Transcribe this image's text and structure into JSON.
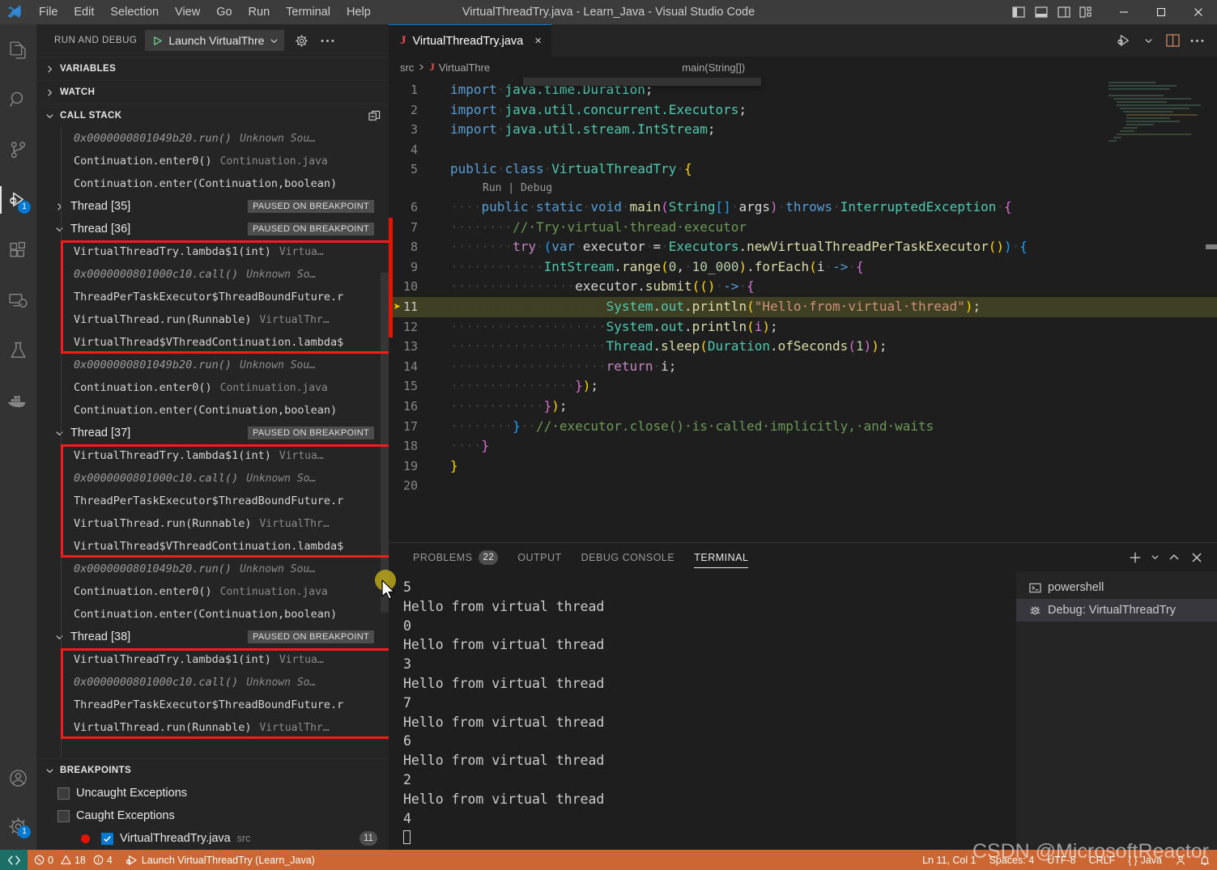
{
  "titlebar": {
    "menus": [
      "File",
      "Edit",
      "Selection",
      "View",
      "Go",
      "Run",
      "Terminal",
      "Help"
    ],
    "window_title": "VirtualThreadTry.java - Learn_Java - Visual Studio Code",
    "layout_icons": [
      "toggle-primary-sidebar-icon",
      "toggle-panel-icon",
      "toggle-secondary-sidebar-icon",
      "customize-layout-icon"
    ],
    "window_controls": [
      "minimize",
      "maximize",
      "close"
    ]
  },
  "activitybar": {
    "items": [
      {
        "name": "explorer-icon",
        "badge": ""
      },
      {
        "name": "search-icon",
        "badge": ""
      },
      {
        "name": "source-control-icon",
        "badge": ""
      },
      {
        "name": "run-and-debug-icon",
        "badge": "1"
      },
      {
        "name": "extensions-icon",
        "badge": ""
      },
      {
        "name": "remote-explorer-icon",
        "badge": ""
      },
      {
        "name": "testing-icon",
        "badge": ""
      },
      {
        "name": "docker-icon",
        "badge": ""
      }
    ],
    "bottom": [
      {
        "name": "accounts-icon",
        "badge": ""
      },
      {
        "name": "settings-gear-icon",
        "badge": "1"
      }
    ]
  },
  "sidebar": {
    "title": "RUN AND DEBUG",
    "launch_config": "Launch VirtualThre",
    "sections": {
      "variables": "VARIABLES",
      "watch": "WATCH",
      "callstack": "CALL STACK",
      "breakpoints": "BREAKPOINTS"
    },
    "paused_badge": "PAUSED ON BREAKPOINT",
    "callstack": [
      {
        "type": "frame",
        "text": "0x0000000801049b20.run()",
        "src": "Unknown Sou…",
        "dim": true
      },
      {
        "type": "frame",
        "text": "Continuation.enter0()",
        "src": "Continuation.java",
        "dim": false
      },
      {
        "type": "frame",
        "text": "Continuation.enter(Continuation,boolean)",
        "src": "",
        "dim": false
      },
      {
        "type": "thread",
        "text": "Thread [35]",
        "expanded": false
      },
      {
        "type": "thread",
        "text": "Thread [36]",
        "expanded": true
      },
      {
        "type": "frame",
        "text": "VirtualThreadTry.lambda$1(int)",
        "src": "Virtua…",
        "dim": false,
        "boxed": true
      },
      {
        "type": "frame",
        "text": "0x0000000801000c10.call()",
        "src": "Unknown So…",
        "dim": true,
        "boxed": true
      },
      {
        "type": "frame",
        "text": "ThreadPerTaskExecutor$ThreadBoundFuture.r",
        "src": "",
        "dim": false,
        "boxed": true
      },
      {
        "type": "frame",
        "text": "VirtualThread.run(Runnable)",
        "src": "VirtualThr…",
        "dim": false,
        "boxed": true
      },
      {
        "type": "frame",
        "text": "VirtualThread$VThreadContinuation.lambda$",
        "src": "",
        "dim": false,
        "boxed": true
      },
      {
        "type": "frame",
        "text": "0x0000000801049b20.run()",
        "src": "Unknown Sou…",
        "dim": true
      },
      {
        "type": "frame",
        "text": "Continuation.enter0()",
        "src": "Continuation.java",
        "dim": false
      },
      {
        "type": "frame",
        "text": "Continuation.enter(Continuation,boolean)",
        "src": "",
        "dim": false
      },
      {
        "type": "thread",
        "text": "Thread [37]",
        "expanded": true
      },
      {
        "type": "frame",
        "text": "VirtualThreadTry.lambda$1(int)",
        "src": "Virtua…",
        "dim": false,
        "boxed": true
      },
      {
        "type": "frame",
        "text": "0x0000000801000c10.call()",
        "src": "Unknown So…",
        "dim": true,
        "boxed": true
      },
      {
        "type": "frame",
        "text": "ThreadPerTaskExecutor$ThreadBoundFuture.r",
        "src": "",
        "dim": false,
        "boxed": true
      },
      {
        "type": "frame",
        "text": "VirtualThread.run(Runnable)",
        "src": "VirtualThr…",
        "dim": false,
        "boxed": true
      },
      {
        "type": "frame",
        "text": "VirtualThread$VThreadContinuation.lambda$",
        "src": "",
        "dim": false,
        "boxed": true
      },
      {
        "type": "frame",
        "text": "0x0000000801049b20.run()",
        "src": "Unknown Sou…",
        "dim": true
      },
      {
        "type": "frame",
        "text": "Continuation.enter0()",
        "src": "Continuation.java",
        "dim": false
      },
      {
        "type": "frame",
        "text": "Continuation.enter(Continuation,boolean)",
        "src": "",
        "dim": false
      },
      {
        "type": "thread",
        "text": "Thread [38]",
        "expanded": true
      },
      {
        "type": "frame",
        "text": "VirtualThreadTry.lambda$1(int)",
        "src": "Virtua…",
        "dim": false,
        "boxed": true
      },
      {
        "type": "frame",
        "text": "0x0000000801000c10.call()",
        "src": "Unknown So…",
        "dim": true,
        "boxed": true
      },
      {
        "type": "frame",
        "text": "ThreadPerTaskExecutor$ThreadBoundFuture.r",
        "src": "",
        "dim": false,
        "boxed": true
      },
      {
        "type": "frame",
        "text": "VirtualThread.run(Runnable)",
        "src": "VirtualThr…",
        "dim": false,
        "boxed": true
      }
    ],
    "breakpoints": [
      {
        "label": "Uncaught Exceptions",
        "checked": false,
        "src": "",
        "count": "",
        "dot": false
      },
      {
        "label": "Caught Exceptions",
        "checked": false,
        "src": "",
        "count": "",
        "dot": false
      },
      {
        "label": "VirtualThreadTry.java",
        "checked": true,
        "src": "src",
        "count": "11",
        "dot": true
      }
    ]
  },
  "editor": {
    "tab": {
      "label": "VirtualThreadTry.java",
      "icon": "java-file-icon",
      "close": "×"
    },
    "tab_actions": [
      "run-or-debug-icon",
      "chevron-down-icon",
      "split-editor-icon",
      "more-actions-icon"
    ],
    "breadcrumb": [
      "src",
      "VirtualThre",
      "main(String[])"
    ],
    "debug_toolbar": [
      "continue-icon",
      "step-over-icon",
      "step-into-icon",
      "step-out-icon",
      "restart-icon",
      "stop-icon",
      "chevron-down-icon",
      "hot-reload-icon"
    ],
    "codelens": "Run | Debug",
    "breakpoint_line": 11,
    "lines": [
      {
        "n": 1,
        "html": "<span class=\"k\">import</span><span class=\"ws\">·</span><span class=\"ty\">java.time.Duration</span><span class=\"pn\">;</span>"
      },
      {
        "n": 2,
        "html": "<span class=\"k\">import</span><span class=\"ws\">·</span><span class=\"ty\">java.util.concurrent.Executors</span><span class=\"pn\">;</span>"
      },
      {
        "n": 3,
        "html": "<span class=\"k\">import</span><span class=\"ws\">·</span><span class=\"ty\">java.util.stream.IntStream</span><span class=\"pn\">;</span>"
      },
      {
        "n": 4,
        "html": ""
      },
      {
        "n": 5,
        "html": "<span class=\"k\">public</span><span class=\"ws\">·</span><span class=\"k\">class</span><span class=\"ws\">·</span><span class=\"ty\">VirtualThreadTry</span><span class=\"ws\">·</span><span class=\"br1\">{</span>"
      },
      {
        "n": 6,
        "html": "<span class=\"ws\">····</span><span class=\"k\">public</span><span class=\"ws\">·</span><span class=\"k\">static</span><span class=\"ws\">·</span><span class=\"k\">void</span><span class=\"ws\">·</span><span class=\"fn\">main</span><span class=\"br2\">(</span><span class=\"ty\">String</span><span class=\"br3\">[]</span><span class=\"ws\">·</span><span class=\"pn\">args</span><span class=\"br2\">)</span><span class=\"ws\">·</span><span class=\"k\">throws</span><span class=\"ws\">·</span><span class=\"ty\">InterruptedException</span><span class=\"ws\">·</span><span class=\"br2\">{</span>"
      },
      {
        "n": 7,
        "html": "<span class=\"ws\">········</span><span class=\"cm\">//·Try·virtual·thread·executor</span>"
      },
      {
        "n": 8,
        "html": "<span class=\"ws\">········</span><span class=\"kw2\">try</span><span class=\"ws\">·</span><span class=\"br3\">(</span><span class=\"k\">var</span><span class=\"ws\">·</span><span class=\"pn\">executor</span><span class=\"ws\">·</span><span class=\"pn\">=</span><span class=\"ws\">·</span><span class=\"ty\">Executors</span><span class=\"pn\">.</span><span class=\"fn\">newVirtualThreadPerTaskExecutor</span><span class=\"br1\">()</span><span class=\"br3\">)</span><span class=\"ws\">·</span><span class=\"br3\">{</span>"
      },
      {
        "n": 9,
        "html": "<span class=\"ws\">············</span><span class=\"ty\">IntStream</span><span class=\"pn\">.</span><span class=\"fn\">range</span><span class=\"br1\">(</span><span class=\"nu\">0</span><span class=\"pn\">,</span><span class=\"ws\">·</span><span class=\"nu\">10_000</span><span class=\"br1\">)</span><span class=\"pn\">.</span><span class=\"fn\">forEach</span><span class=\"br1\">(</span><span class=\"pn\">i</span><span class=\"ws\">·</span><span class=\"k\">-&gt;</span><span class=\"ws\">·</span><span class=\"br2\">{</span>"
      },
      {
        "n": 10,
        "html": "<span class=\"ws\">················</span><span class=\"pn\">executor</span><span class=\"pn\">.</span><span class=\"fn\">submit</span><span class=\"br1\">((</span><span class=\"br1\">)</span><span class=\"ws\">·</span><span class=\"k\">-&gt;</span><span class=\"ws\">·</span><span class=\"br2\">{</span>"
      },
      {
        "n": 11,
        "html": "<span class=\"ws\">····················</span><span class=\"ty\">System</span><span class=\"pn\">.</span><span class=\"ty\">out</span><span class=\"pn\">.</span><span class=\"fn\">println</span><span class=\"br1\">(</span><span class=\"st\">\"Hello·from·virtual·thread\"</span><span class=\"br1\">)</span><span class=\"pn\">;</span>"
      },
      {
        "n": 12,
        "html": "<span class=\"ws\">····················</span><span class=\"ty\">System</span><span class=\"pn\">.</span><span class=\"ty\">out</span><span class=\"pn\">.</span><span class=\"fn\">println</span><span class=\"br1\">(</span><span class=\"br2\">i</span><span class=\"br1\">)</span><span class=\"pn\">;</span>"
      },
      {
        "n": 13,
        "html": "<span class=\"ws\">····················</span><span class=\"ty\">Thread</span><span class=\"pn\">.</span><span class=\"fn\">sleep</span><span class=\"br1\">(</span><span class=\"ty\">Duration</span><span class=\"pn\">.</span><span class=\"fn\">ofSeconds</span><span class=\"br2\">(</span><span class=\"nu\">1</span><span class=\"br2\">)</span><span class=\"br1\">)</span><span class=\"pn\">;</span>"
      },
      {
        "n": 14,
        "html": "<span class=\"ws\">····················</span><span class=\"kw2\">return</span><span class=\"ws\">·</span><span class=\"pn\">i</span><span class=\"pn\">;</span>"
      },
      {
        "n": 15,
        "html": "<span class=\"ws\">················</span><span class=\"br2\">}</span><span class=\"br1\">)</span><span class=\"pn\">;</span>"
      },
      {
        "n": 16,
        "html": "<span class=\"ws\">············</span><span class=\"br2\">}</span><span class=\"br1\">)</span><span class=\"pn\">;</span>"
      },
      {
        "n": 17,
        "html": "<span class=\"ws\">········</span><span class=\"br3\">}</span><span class=\"ws\">··</span><span class=\"cm\">//·executor.close()·is·called·implicitly,·and·waits</span>"
      },
      {
        "n": 18,
        "html": "<span class=\"ws\">····</span><span class=\"br2\">}</span>"
      },
      {
        "n": 19,
        "html": "<span class=\"br1\">}</span>"
      },
      {
        "n": 20,
        "html": ""
      }
    ]
  },
  "panel": {
    "tabs": [
      {
        "label": "PROBLEMS",
        "count": "22",
        "active": false
      },
      {
        "label": "OUTPUT",
        "count": "",
        "active": false
      },
      {
        "label": "DEBUG CONSOLE",
        "count": "",
        "active": false
      },
      {
        "label": "TERMINAL",
        "count": "",
        "active": true
      }
    ],
    "actions": [
      "add-terminal-icon",
      "chevron-down-icon",
      "maximize-panel-icon",
      "close-panel-icon"
    ],
    "terminal_output": [
      "5",
      "Hello from virtual thread",
      "0",
      "Hello from virtual thread",
      "3",
      "Hello from virtual thread",
      "7",
      "Hello from virtual thread",
      "6",
      "Hello from virtual thread",
      "2",
      "Hello from virtual thread",
      "4"
    ],
    "terminal_list": [
      {
        "label": "powershell",
        "icon": "terminal-powershell-icon",
        "active": false
      },
      {
        "label": "Debug: VirtualThreadTry",
        "icon": "debug-icon",
        "active": true
      }
    ]
  },
  "statusbar": {
    "remote_icon": "remote-window-icon",
    "errors": "0",
    "warnings": "18",
    "infos": "4",
    "launch": "Launch VirtualThreadTry (Learn_Java)",
    "cursor": "Ln 11, Col 1",
    "spaces": "Spaces: 4",
    "encoding": "UTF-8",
    "eol": "CRLF",
    "language": "Java",
    "right_icons": [
      "accounts-status-icon",
      "notifications-bell-icon"
    ]
  },
  "watermark": "CSDN @MicrosoftReactor",
  "colors": {
    "accent": "#0078d4",
    "statusbar_bg": "#cc6633",
    "highlight_box": "#f81b1b",
    "breakpoint_red": "#e51400",
    "debug_line": "#6b6b2c"
  }
}
